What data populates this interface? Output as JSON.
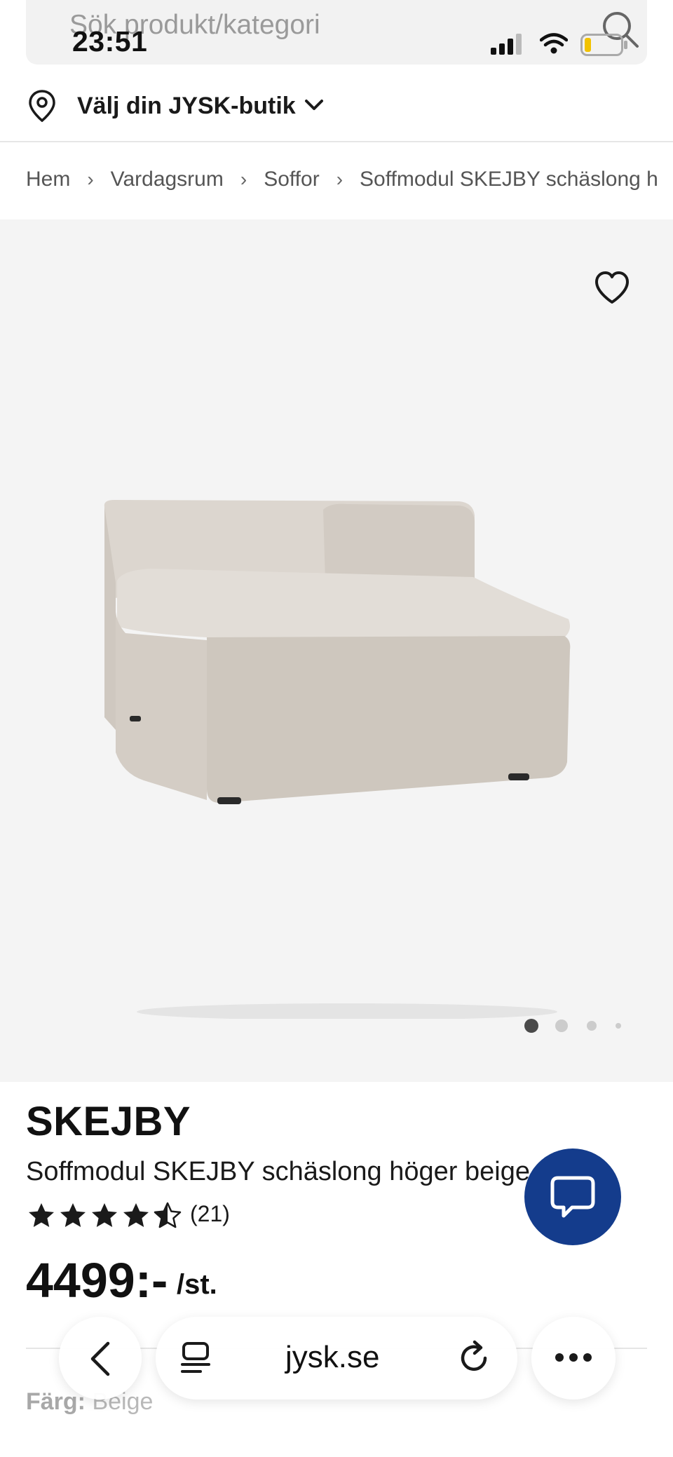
{
  "status_bar": {
    "time": "23:51"
  },
  "search": {
    "placeholder": "Sök produkt/kategori"
  },
  "store": {
    "label": "Välj din JYSK-butik"
  },
  "breadcrumb": {
    "items": [
      "Hem",
      "Vardagsrum",
      "Soffor",
      "Soffmodul SKEJBY schäslong h"
    ],
    "separator": "›"
  },
  "gallery": {
    "image_count": 4,
    "active_index": 0
  },
  "product": {
    "brand": "SKEJBY",
    "name": "Soffmodul SKEJBY schäslong höger beige",
    "rating": 4.5,
    "rating_max": 5,
    "rating_count": "(21)",
    "price": "4499:-",
    "price_unit": "/st.",
    "color_label": "Färg:",
    "color_value": "Beige"
  },
  "browser": {
    "url": "jysk.se"
  },
  "colors": {
    "chat_button": "#143c8c",
    "gallery_bg": "#f4f4f4",
    "sofa": "#d9d3cc"
  },
  "icons": [
    "search-icon",
    "signal-icon",
    "wifi-icon",
    "battery-icon",
    "location-pin-icon",
    "chevron-down-icon",
    "chevron-right-icon",
    "heart-icon",
    "star-icon",
    "chat-icon",
    "back-icon",
    "reader-icon",
    "reload-icon",
    "more-icon"
  ]
}
